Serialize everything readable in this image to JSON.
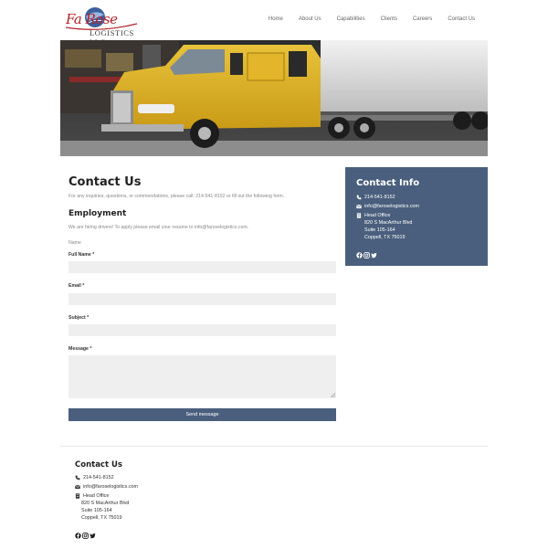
{
  "header": {
    "logo_script": "Fa Rose",
    "logo_llc": "LOGISTICS LLC",
    "nav": [
      "Home",
      "About Us",
      "Capabilities",
      "Clients",
      "Careers",
      "Contact Us"
    ]
  },
  "main": {
    "title": "Contact Us",
    "intro": "For any inquiries, questions, or commendations, please call: 214-541-8152 or fill out the following form.",
    "employment_title": "Employment",
    "employment_text": "We are hiring drivers! To apply please email your resume to info@faroselogistics.com.",
    "name_legend": "Name",
    "fields": {
      "full_name": "Full Name *",
      "email": "Email *",
      "subject": "Subject *",
      "message": "Message *"
    },
    "send_label": "Send message"
  },
  "contact": {
    "title": "Contact Info",
    "phone": "214-541-8152",
    "email": "info@faroselogistics.com",
    "office_label": "Head Office",
    "address": [
      "820 S MacArthur Blvd",
      "Suite 105-164",
      "Coppell, TX 75019"
    ]
  },
  "footer": {
    "title": "Contact Us"
  },
  "colors": {
    "accent": "#4a5f7d",
    "brand_red": "#b3232b",
    "field_bg": "#efefef"
  },
  "icons": [
    "phone-icon",
    "envelope-icon",
    "building-icon",
    "facebook-icon",
    "instagram-icon",
    "twitter-icon"
  ]
}
